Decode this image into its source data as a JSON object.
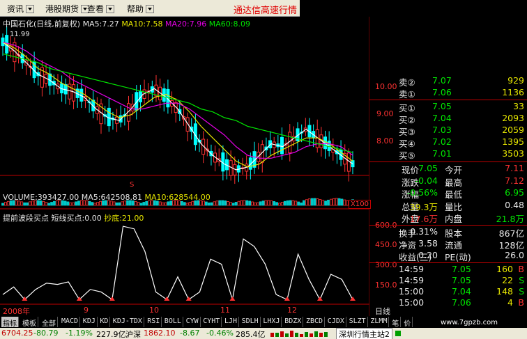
{
  "menu": {
    "items": [
      "资讯",
      "港股期货",
      "查看",
      "帮助"
    ],
    "title": "通达信高速行情"
  },
  "chart": {
    "header": {
      "name": "中国石化(日线,前复权)",
      "ma5": "MA5:7.27",
      "ma10": "MA10:7.58",
      "ma20": "MA20:7.96",
      "ma60": "MA60:8.09"
    },
    "high_label": "11.99",
    "low_label": "S",
    "price_ticks": [
      "10.00",
      "9.00",
      "8.00"
    ],
    "volume_header": {
      "volume": "VOLUME:393427.00",
      "ma5": "MA5:642508.81",
      "ma10": "MA10:628544.00"
    },
    "volume_unit": "X100",
    "indicator_header": {
      "name": "提前波段买点",
      "line": "短线买点:0.00",
      "bottom": "抄底:21.00"
    },
    "indicator_ticks": [
      "600.0",
      "450.0",
      "300.0",
      "150.0"
    ],
    "date_labels": [
      "2008年",
      "9",
      "10",
      "11",
      "12"
    ],
    "period": "日线",
    "colors": {
      "ma5": "#ffffff",
      "ma10": "#e6e600",
      "ma20": "#e600e6",
      "ma60": "#00e600",
      "up": "#ff3232",
      "down": "#00ffff"
    },
    "chart_data": {
      "type": "line",
      "series": [
        {
          "name": "MA5",
          "values": [
            11.9,
            11.6,
            11.2,
            10.8,
            10.6,
            10.3,
            10.2,
            10.0,
            9.6,
            9.3,
            9.2,
            9.6,
            10.1,
            10.3,
            10.0,
            9.6,
            9.0,
            8.4,
            8.0,
            7.7,
            7.5,
            7.6,
            8.0,
            8.4,
            8.3,
            8.6,
            8.9,
            8.6,
            8.3,
            8.0,
            7.7
          ]
        },
        {
          "name": "MA10",
          "values": [
            11.9,
            11.7,
            11.4,
            11.0,
            10.8,
            10.5,
            10.3,
            10.1,
            9.8,
            9.5,
            9.3,
            9.4,
            9.7,
            10.0,
            10.1,
            9.9,
            9.5,
            9.0,
            8.6,
            8.2,
            7.8,
            7.6,
            7.7,
            8.0,
            8.2,
            8.4,
            8.6,
            8.6,
            8.4,
            8.1,
            7.8
          ]
        },
        {
          "name": "MA20",
          "values": [
            11.9,
            11.8,
            11.6,
            11.3,
            11.1,
            10.9,
            10.6,
            10.4,
            10.2,
            10.0,
            9.8,
            9.6,
            9.6,
            9.7,
            9.8,
            9.8,
            9.6,
            9.3,
            9.0,
            8.7,
            8.3,
            8.0,
            7.9,
            7.9,
            8.0,
            8.1,
            8.3,
            8.4,
            8.4,
            8.3,
            8.0
          ]
        },
        {
          "name": "MA60",
          "values": [
            11.5,
            11.4,
            11.3,
            11.2,
            11.0,
            10.9,
            10.8,
            10.7,
            10.6,
            10.5,
            10.4,
            10.3,
            10.2,
            10.1,
            10.0,
            9.9,
            9.8,
            9.6,
            9.5,
            9.3,
            9.2,
            9.0,
            8.9,
            8.8,
            8.7,
            8.6,
            8.5,
            8.4,
            8.3,
            8.2,
            8.1
          ]
        }
      ],
      "ylim": [
        7.5,
        12.3
      ]
    },
    "indicator_data": [
      60,
      120,
      20,
      100,
      150,
      140,
      160,
      20,
      100,
      80,
      20,
      600,
      580,
      400,
      80,
      20,
      200,
      20,
      80,
      340,
      300,
      20,
      500,
      440,
      300,
      60,
      20,
      380,
      180,
      20,
      220,
      180,
      20
    ]
  },
  "quote": {
    "sell": [
      {
        "label": "卖②",
        "price": "7.07",
        "vol": "929"
      },
      {
        "label": "卖①",
        "price": "7.06",
        "vol": "1136"
      }
    ],
    "buy": [
      {
        "label": "买①",
        "price": "7.05",
        "vol": "33"
      },
      {
        "label": "买②",
        "price": "7.04",
        "vol": "2093"
      },
      {
        "label": "买③",
        "price": "7.03",
        "vol": "2059"
      },
      {
        "label": "买④",
        "price": "7.02",
        "vol": "1395"
      },
      {
        "label": "买⑤",
        "price": "7.01",
        "vol": "3503"
      }
    ],
    "stats": [
      {
        "l1": "现价",
        "v1": "7.05",
        "l2": "今开",
        "v2": "7.11",
        "c1": "green",
        "c2": "red"
      },
      {
        "l1": "涨跌",
        "v1": "-0.04",
        "l2": "最高",
        "v2": "7.12",
        "c1": "green",
        "c2": "red"
      },
      {
        "l1": "涨幅",
        "v1": "-0.56%",
        "l2": "最低",
        "v2": "6.95",
        "c1": "green",
        "c2": "green"
      },
      {
        "l1": "总量",
        "v1": "39.3万",
        "l2": "量比",
        "v2": "0.48",
        "c1": "yellow",
        "c2": "white"
      },
      {
        "l1": "外盘",
        "v1": "17.6万",
        "l2": "内盘",
        "v2": "21.8万",
        "c1": "red",
        "c2": "green"
      }
    ],
    "fin": [
      {
        "l1": "换手",
        "v1": "0.31%",
        "l2": "股本",
        "v2": "867亿"
      },
      {
        "l1": "净资",
        "v1": "3.58",
        "l2": "流通",
        "v2": "128亿"
      },
      {
        "l1": "收益(三)",
        "v1": "0.20",
        "l2": "PE(动)",
        "v2": "26.0"
      }
    ],
    "ticks": [
      {
        "time": "14:59",
        "price": "7.05",
        "vol": "160",
        "side": "B"
      },
      {
        "time": "14:59",
        "price": "7.05",
        "vol": "22",
        "side": "S"
      },
      {
        "time": "15:00",
        "price": "7.04",
        "vol": "148",
        "side": "S"
      },
      {
        "time": "15:00",
        "price": "7.06",
        "vol": "4",
        "side": "B"
      }
    ]
  },
  "tabs": [
    "指标",
    "模板",
    "全部",
    "MACD",
    "KDJ",
    "KD",
    "KDJ-TDX",
    "RSI",
    "BOLL",
    "CYW",
    "CYHT",
    "LJH",
    "SDLH",
    "LHXJ",
    "BDZX",
    "ZBCD",
    "CJDX",
    "SLZT",
    "ZLMM",
    "笔",
    "价"
  ],
  "status": {
    "index1": "6704.25",
    "chg1": "-80.79",
    "pct1": "-1.19%",
    "amt1": "227.9亿",
    "name2": "沪深",
    "index2": "1862.10",
    "chg2": "-8.67",
    "pct2": "-0.46%",
    "amt2": "285.4亿",
    "server": "深圳行情主站2"
  },
  "watermark": "www.7gpzb.com"
}
